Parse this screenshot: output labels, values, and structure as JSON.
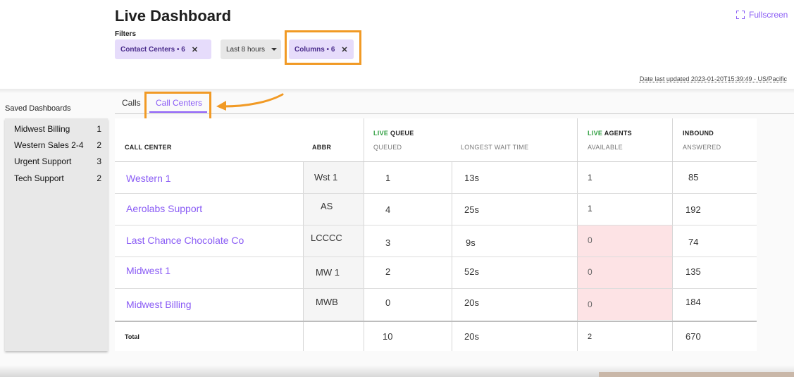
{
  "header": {
    "title": "Live Dashboard",
    "filters_label": "Filters",
    "filters": {
      "contact_centers": "Contact Centers • 6",
      "time_range": "Last 8 hours",
      "columns": "Columns • 6"
    },
    "fullscreen_label": "Fullscreen",
    "last_updated": "Date last updated 2023-01-20T15:39:49 - US/Pacific"
  },
  "sidebar": {
    "title": "Saved Dashboards",
    "items": [
      {
        "label": "Midwest Billing",
        "count": "1"
      },
      {
        "label": "Western Sales 2-4",
        "count": "2"
      },
      {
        "label": "Urgent Support",
        "count": "3"
      },
      {
        "label": "Tech Support",
        "count": "2"
      }
    ]
  },
  "tabs": [
    {
      "label": "Calls",
      "active": false
    },
    {
      "label": "Call Centers",
      "active": true
    }
  ],
  "table": {
    "headers": {
      "call_center": "CALL CENTER",
      "abbr": "ABBR",
      "live_prefix": "LIVE",
      "queue_group": "QUEUE",
      "queued": "QUEUED",
      "longest_wait": "LONGEST WAIT TIME",
      "agents_group": "AGENTS",
      "available": "AVAILABLE",
      "inbound_group": "INBOUND",
      "answered": "ANSWERED"
    },
    "rows": [
      {
        "name": "Western 1",
        "abbr": "Wst 1",
        "queued": "1",
        "wait": "13s",
        "available": "1",
        "answered": "85"
      },
      {
        "name": "Aerolabs Support",
        "abbr": "AS",
        "queued": "4",
        "wait": "25s",
        "available": "1",
        "answered": "192"
      },
      {
        "name": "Last Chance Chocolate Co",
        "abbr": "LCCCC",
        "queued": "3",
        "wait": "9s",
        "available": "0",
        "answered": "74"
      },
      {
        "name": "Midwest 1",
        "abbr": "MW 1",
        "queued": "2",
        "wait": "52s",
        "available": "0",
        "answered": "135"
      },
      {
        "name": "Midwest Billing",
        "abbr": "MWB",
        "queued": "0",
        "wait": "20s",
        "available": "0",
        "answered": "184"
      }
    ],
    "total": {
      "label": "Total",
      "queued": "10",
      "wait": "20s",
      "available": "2",
      "answered": "670"
    }
  },
  "colors": {
    "accent": "#8a5cf5",
    "highlight": "#f19a25",
    "live_green": "#2e9e3f",
    "warning_cell": "#fde3e5"
  }
}
